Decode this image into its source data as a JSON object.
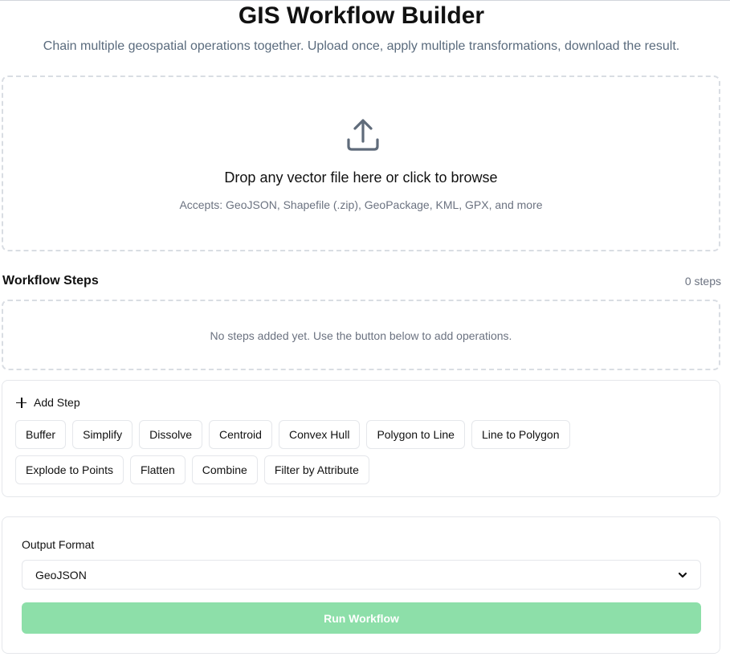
{
  "header": {
    "title": "GIS Workflow Builder",
    "subtitle": "Chain multiple geospatial operations together. Upload once, apply multiple transformations, download the result."
  },
  "dropzone": {
    "icon": "upload-icon",
    "title": "Drop any vector file here or click to browse",
    "accepts": "Accepts: GeoJSON, Shapefile (.zip), GeoPackage, KML, GPX, and more"
  },
  "workflow": {
    "title": "Workflow Steps",
    "count": "0 steps",
    "empty_message": "No steps added yet. Use the button below to add operations."
  },
  "add_step": {
    "label": "Add Step",
    "icon": "plus-icon",
    "operations_row1": [
      "Buffer",
      "Simplify",
      "Dissolve",
      "Centroid",
      "Convex Hull",
      "Polygon to Line",
      "Line to Polygon"
    ],
    "operations_row2": [
      "Explode to Points",
      "Flatten",
      "Combine",
      "Filter by Attribute"
    ]
  },
  "output": {
    "label": "Output Format",
    "selected": "GeoJSON",
    "run_label": "Run Workflow",
    "run_color": "#8ddfa9"
  }
}
